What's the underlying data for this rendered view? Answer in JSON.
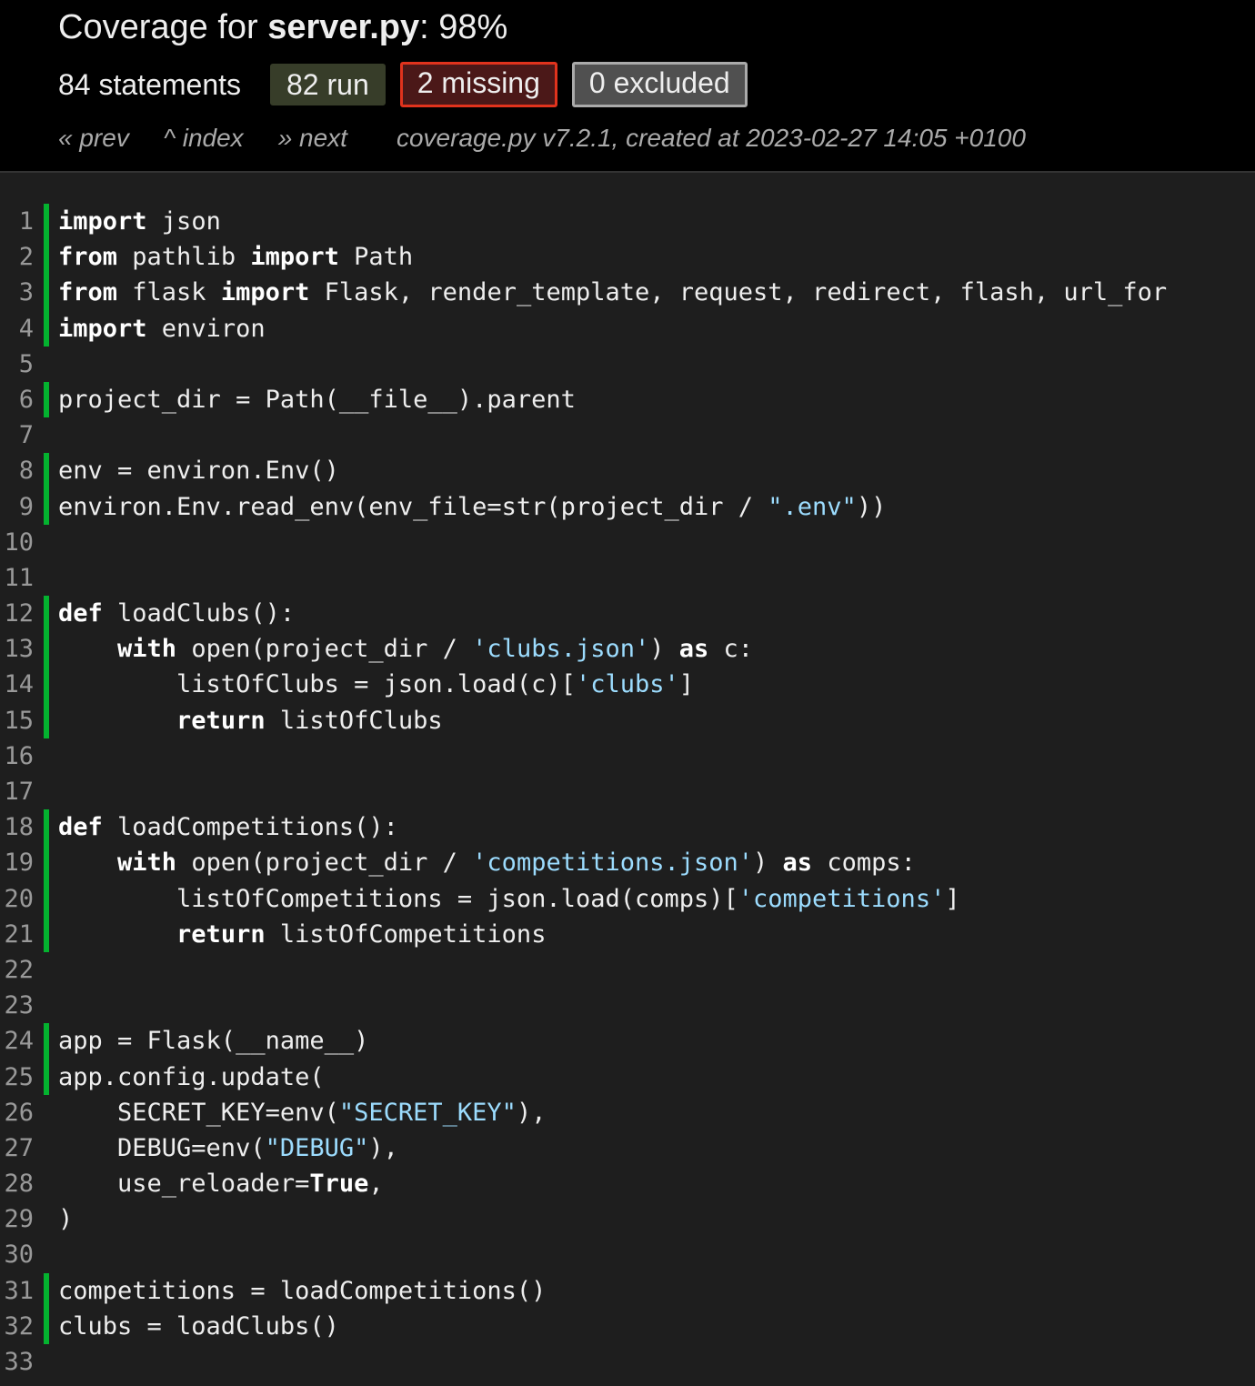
{
  "header": {
    "title_prefix": "Coverage for ",
    "file_name": "server.py",
    "title_suffix": ": 98%",
    "statements": "84 statements",
    "run_badge": "82 run",
    "missing_badge": "2 missing",
    "excluded_badge": "0 excluded"
  },
  "nav": {
    "prev": "« prev",
    "index": "^ index",
    "next": "» next",
    "meta": "coverage.py v7.2.1, created at 2023-02-27 14:05 +0100"
  },
  "colors": {
    "run": "#00cc33",
    "missing": "#e0331d",
    "string": "#9cdcfe",
    "background": "#1e1e1e"
  },
  "lines": [
    {
      "n": "1",
      "run": true,
      "tokens": [
        [
          "kw",
          "import"
        ],
        [
          "t",
          " json"
        ]
      ]
    },
    {
      "n": "2",
      "run": true,
      "tokens": [
        [
          "kw",
          "from"
        ],
        [
          "t",
          " pathlib "
        ],
        [
          "kw",
          "import"
        ],
        [
          "t",
          " Path"
        ]
      ]
    },
    {
      "n": "3",
      "run": true,
      "tokens": [
        [
          "kw",
          "from"
        ],
        [
          "t",
          " flask "
        ],
        [
          "kw",
          "import"
        ],
        [
          "t",
          " Flask, render_template, request, redirect, flash, url_for"
        ]
      ]
    },
    {
      "n": "4",
      "run": true,
      "tokens": [
        [
          "kw",
          "import"
        ],
        [
          "t",
          " environ"
        ]
      ]
    },
    {
      "n": "5",
      "run": false,
      "tokens": []
    },
    {
      "n": "6",
      "run": true,
      "tokens": [
        [
          "t",
          "project_dir = Path(__file__).parent"
        ]
      ]
    },
    {
      "n": "7",
      "run": false,
      "tokens": []
    },
    {
      "n": "8",
      "run": true,
      "tokens": [
        [
          "t",
          "env = environ.Env()"
        ]
      ]
    },
    {
      "n": "9",
      "run": true,
      "tokens": [
        [
          "t",
          "environ.Env.read_env(env_file=str(project_dir / "
        ],
        [
          "str",
          "\".env\""
        ],
        [
          "t",
          "))"
        ]
      ]
    },
    {
      "n": "10",
      "run": false,
      "tokens": []
    },
    {
      "n": "11",
      "run": false,
      "tokens": []
    },
    {
      "n": "12",
      "run": true,
      "tokens": [
        [
          "kw",
          "def"
        ],
        [
          "t",
          " loadClubs():"
        ]
      ]
    },
    {
      "n": "13",
      "run": true,
      "tokens": [
        [
          "t",
          "    "
        ],
        [
          "kw",
          "with"
        ],
        [
          "t",
          " open(project_dir / "
        ],
        [
          "str",
          "'clubs.json'"
        ],
        [
          "t",
          ") "
        ],
        [
          "kw",
          "as"
        ],
        [
          "t",
          " c:"
        ]
      ]
    },
    {
      "n": "14",
      "run": true,
      "tokens": [
        [
          "t",
          "        listOfClubs = json.load(c)["
        ],
        [
          "str",
          "'clubs'"
        ],
        [
          "t",
          "]"
        ]
      ]
    },
    {
      "n": "15",
      "run": true,
      "tokens": [
        [
          "t",
          "        "
        ],
        [
          "kw",
          "return"
        ],
        [
          "t",
          " listOfClubs"
        ]
      ]
    },
    {
      "n": "16",
      "run": false,
      "tokens": []
    },
    {
      "n": "17",
      "run": false,
      "tokens": []
    },
    {
      "n": "18",
      "run": true,
      "tokens": [
        [
          "kw",
          "def"
        ],
        [
          "t",
          " loadCompetitions():"
        ]
      ]
    },
    {
      "n": "19",
      "run": true,
      "tokens": [
        [
          "t",
          "    "
        ],
        [
          "kw",
          "with"
        ],
        [
          "t",
          " open(project_dir / "
        ],
        [
          "str",
          "'competitions.json'"
        ],
        [
          "t",
          ") "
        ],
        [
          "kw",
          "as"
        ],
        [
          "t",
          " comps:"
        ]
      ]
    },
    {
      "n": "20",
      "run": true,
      "tokens": [
        [
          "t",
          "        listOfCompetitions = json.load(comps)["
        ],
        [
          "str",
          "'competitions'"
        ],
        [
          "t",
          "]"
        ]
      ]
    },
    {
      "n": "21",
      "run": true,
      "tokens": [
        [
          "t",
          "        "
        ],
        [
          "kw",
          "return"
        ],
        [
          "t",
          " listOfCompetitions"
        ]
      ]
    },
    {
      "n": "22",
      "run": false,
      "tokens": []
    },
    {
      "n": "23",
      "run": false,
      "tokens": []
    },
    {
      "n": "24",
      "run": true,
      "tokens": [
        [
          "t",
          "app = Flask(__name__)"
        ]
      ]
    },
    {
      "n": "25",
      "run": true,
      "tokens": [
        [
          "t",
          "app.config.update("
        ]
      ]
    },
    {
      "n": "26",
      "run": false,
      "tokens": [
        [
          "t",
          "    SECRET_KEY=env("
        ],
        [
          "str",
          "\"SECRET_KEY\""
        ],
        [
          "t",
          "),"
        ]
      ]
    },
    {
      "n": "27",
      "run": false,
      "tokens": [
        [
          "t",
          "    DEBUG=env("
        ],
        [
          "str",
          "\"DEBUG\""
        ],
        [
          "t",
          "),"
        ]
      ]
    },
    {
      "n": "28",
      "run": false,
      "tokens": [
        [
          "t",
          "    use_reloader="
        ],
        [
          "kw",
          "True"
        ],
        [
          "t",
          ","
        ]
      ]
    },
    {
      "n": "29",
      "run": false,
      "tokens": [
        [
          "t",
          ")"
        ]
      ]
    },
    {
      "n": "30",
      "run": false,
      "tokens": []
    },
    {
      "n": "31",
      "run": true,
      "tokens": [
        [
          "t",
          "competitions = loadCompetitions()"
        ]
      ]
    },
    {
      "n": "32",
      "run": true,
      "tokens": [
        [
          "t",
          "clubs = loadClubs()"
        ]
      ]
    },
    {
      "n": "33",
      "run": false,
      "tokens": []
    }
  ]
}
